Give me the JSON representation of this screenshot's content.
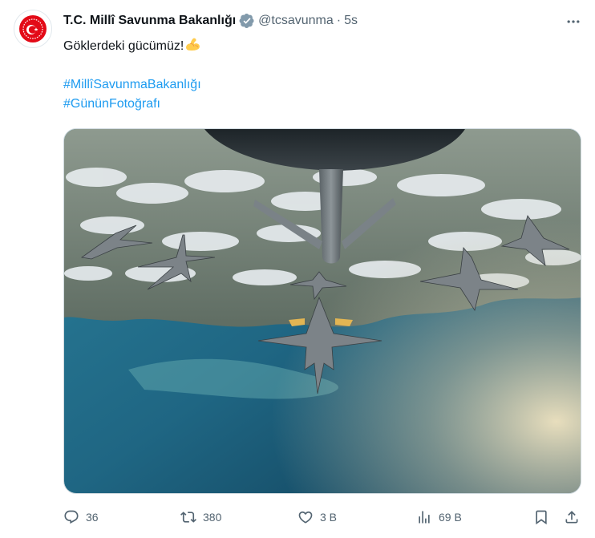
{
  "tweet": {
    "display_name": "T.C. Millî Savunma Bakanlığı",
    "handle": "@tcsavunma",
    "separator": "·",
    "time": "5s",
    "text": "Göklerdeki gücümüz!",
    "emoji": "flexed-biceps",
    "hashtags": [
      "#MillîSavunmaBakanlığı",
      "#GününFotoğrafı"
    ],
    "media_alt": "Refueling aircraft boom above six fighter jets in formation over coastline and clouds"
  },
  "actions": {
    "replies": "36",
    "retweets": "380",
    "likes": "3 B",
    "views": "69 B"
  },
  "colors": {
    "accent": "#1d9bf0",
    "text": "#0f1419",
    "muted": "#536471",
    "avatar_red": "#e30a17"
  }
}
